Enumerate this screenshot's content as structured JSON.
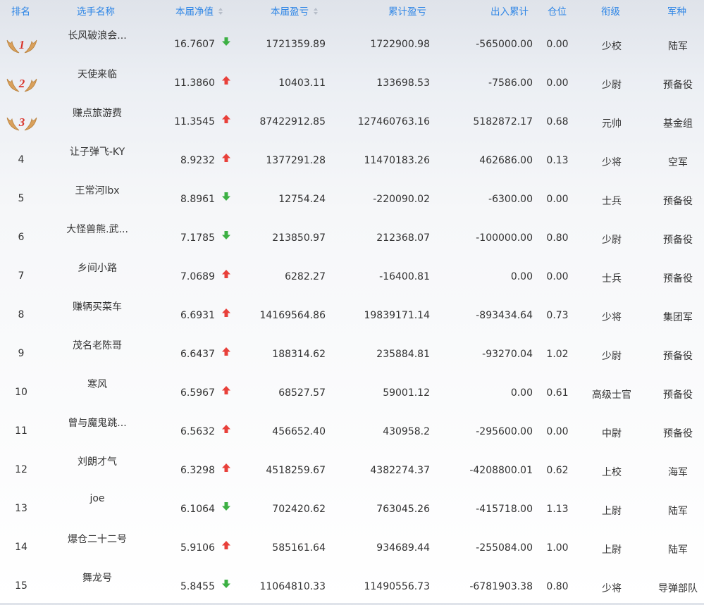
{
  "headers": {
    "rank": "排名",
    "name": "选手名称",
    "nav": "本届净值",
    "profit": "本届盈亏",
    "cum_profit": "累计盈亏",
    "flow": "出入累计",
    "position": "仓位",
    "title": "衔级",
    "arm": "军种"
  },
  "colors": {
    "header_text": "#2f86e6",
    "up": "#e8403a",
    "down": "#3cb043",
    "medal": "#d9a05b",
    "medal_num": "#d9342b"
  },
  "rows": [
    {
      "rank": "1",
      "medal": true,
      "name": "长风破浪会...",
      "nav": "16.7607",
      "dir": "down",
      "profit": "1721359.89",
      "cum": "1722900.98",
      "flow": "-565000.00",
      "pos": "0.00",
      "title": "少校",
      "arm": "陆军"
    },
    {
      "rank": "2",
      "medal": true,
      "name": "天使来临",
      "nav": "11.3860",
      "dir": "up",
      "profit": "10403.11",
      "cum": "133698.53",
      "flow": "-7586.00",
      "pos": "0.00",
      "title": "少尉",
      "arm": "预备役"
    },
    {
      "rank": "3",
      "medal": true,
      "name": "赚点旅游费",
      "nav": "11.3545",
      "dir": "up",
      "profit": "87422912.85",
      "cum": "127460763.16",
      "flow": "5182872.17",
      "pos": "0.68",
      "title": "元帅",
      "arm": "基金组"
    },
    {
      "rank": "4",
      "medal": false,
      "name": "让子弹飞-KY",
      "nav": "8.9232",
      "dir": "up",
      "profit": "1377291.28",
      "cum": "11470183.26",
      "flow": "462686.00",
      "pos": "0.13",
      "title": "少将",
      "arm": "空军"
    },
    {
      "rank": "5",
      "medal": false,
      "name": "王常河lbx",
      "nav": "8.8961",
      "dir": "down",
      "profit": "12754.24",
      "cum": "-220090.02",
      "flow": "-6300.00",
      "pos": "0.00",
      "title": "士兵",
      "arm": "预备役"
    },
    {
      "rank": "6",
      "medal": false,
      "name": "大怪兽熊.武...",
      "nav": "7.1785",
      "dir": "down",
      "profit": "213850.97",
      "cum": "212368.07",
      "flow": "-100000.00",
      "pos": "0.80",
      "title": "少尉",
      "arm": "预备役"
    },
    {
      "rank": "7",
      "medal": false,
      "name": "乡间小路",
      "nav": "7.0689",
      "dir": "up",
      "profit": "6282.27",
      "cum": "-16400.81",
      "flow": "0.00",
      "pos": "0.00",
      "title": "士兵",
      "arm": "预备役"
    },
    {
      "rank": "8",
      "medal": false,
      "name": "赚辆买菜车",
      "nav": "6.6931",
      "dir": "up",
      "profit": "14169564.86",
      "cum": "19839171.14",
      "flow": "-893434.64",
      "pos": "0.73",
      "title": "少将",
      "arm": "集团军"
    },
    {
      "rank": "9",
      "medal": false,
      "name": "茂名老陈哥",
      "nav": "6.6437",
      "dir": "up",
      "profit": "188314.62",
      "cum": "235884.81",
      "flow": "-93270.04",
      "pos": "1.02",
      "title": "少尉",
      "arm": "预备役"
    },
    {
      "rank": "10",
      "medal": false,
      "name": "寒风",
      "nav": "6.5967",
      "dir": "up",
      "profit": "68527.57",
      "cum": "59001.12",
      "flow": "0.00",
      "pos": "0.61",
      "title": "高级士官",
      "arm": "预备役"
    },
    {
      "rank": "11",
      "medal": false,
      "name": "曾与魔鬼跳...",
      "nav": "6.5632",
      "dir": "up",
      "profit": "456652.40",
      "cum": "430958.2",
      "flow": "-295600.00",
      "pos": "0.00",
      "title": "中尉",
      "arm": "预备役"
    },
    {
      "rank": "12",
      "medal": false,
      "name": "刘朗才气",
      "nav": "6.3298",
      "dir": "up",
      "profit": "4518259.67",
      "cum": "4382274.37",
      "flow": "-4208800.01",
      "pos": "0.62",
      "title": "上校",
      "arm": "海军"
    },
    {
      "rank": "13",
      "medal": false,
      "name": "joe",
      "nav": "6.1064",
      "dir": "down",
      "profit": "702420.62",
      "cum": "763045.26",
      "flow": "-415718.00",
      "pos": "1.13",
      "title": "上尉",
      "arm": "陆军"
    },
    {
      "rank": "14",
      "medal": false,
      "name": "爆仓二十二号",
      "nav": "5.9106",
      "dir": "up",
      "profit": "585161.64",
      "cum": "934689.44",
      "flow": "-255084.00",
      "pos": "1.00",
      "title": "上尉",
      "arm": "陆军"
    },
    {
      "rank": "15",
      "medal": false,
      "name": "舞龙号",
      "nav": "5.8455",
      "dir": "down",
      "profit": "11064810.33",
      "cum": "11490556.73",
      "flow": "-6781903.38",
      "pos": "0.80",
      "title": "少将",
      "arm": "导弹部队"
    }
  ]
}
